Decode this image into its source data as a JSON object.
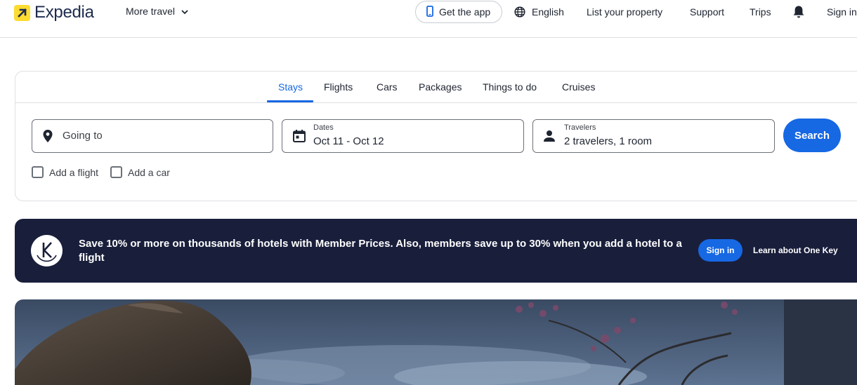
{
  "header": {
    "logo_text": "Expedia",
    "more_travel": "More travel",
    "get_app": "Get the app",
    "language": "English",
    "list_property": "List your property",
    "support": "Support",
    "trips": "Trips",
    "sign_in": "Sign in",
    "icons": [
      "expedia-logo-icon",
      "chevron-down-icon",
      "phone-icon",
      "globe-icon",
      "bell-icon"
    ]
  },
  "search": {
    "tabs": [
      {
        "label": "Stays",
        "active": true
      },
      {
        "label": "Flights",
        "active": false
      },
      {
        "label": "Cars",
        "active": false
      },
      {
        "label": "Packages",
        "active": false
      },
      {
        "label": "Things to do",
        "active": false
      },
      {
        "label": "Cruises",
        "active": false
      }
    ],
    "going_to": {
      "placeholder": "Going to",
      "value": ""
    },
    "dates": {
      "label": "Dates",
      "value": "Oct 11 - Oct 12"
    },
    "travelers": {
      "label": "Travelers",
      "value": "2 travelers, 1 room"
    },
    "search_button": "Search",
    "add_flight": {
      "label": "Add a flight",
      "checked": false
    },
    "add_car": {
      "label": "Add a car",
      "checked": false
    }
  },
  "banner": {
    "text": "Save 10% or more on thousands of hotels with Member Prices. Also, members save up to 30% when you add a hotel to a flight",
    "sign_in": "Sign in",
    "learn_more": "Learn about One Key"
  },
  "colors": {
    "brand_blue": "#1668e3",
    "logo_yellow": "#fddb32",
    "banner_navy": "#191e3b",
    "text_dark": "#1e2430"
  }
}
